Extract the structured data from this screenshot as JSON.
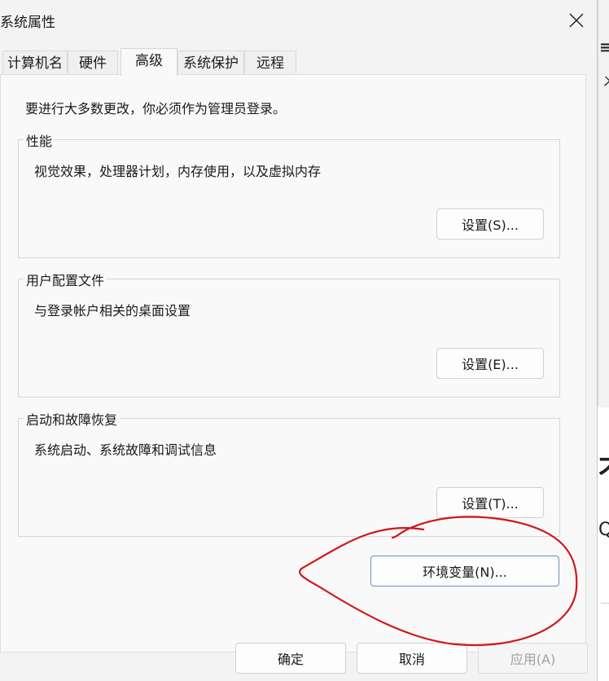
{
  "window": {
    "title": "系统属性"
  },
  "tabs": [
    {
      "label": "计算机名",
      "active": false
    },
    {
      "label": "硬件",
      "active": false
    },
    {
      "label": "高级",
      "active": true
    },
    {
      "label": "系统保护",
      "active": false
    },
    {
      "label": "远程",
      "active": false
    }
  ],
  "advanced": {
    "intro": "要进行大多数更改，你必须作为管理员登录。",
    "performance": {
      "title": "性能",
      "description": "视觉效果，处理器计划，内存使用，以及虚拟内存",
      "button": "设置(S)..."
    },
    "user_profiles": {
      "title": "用户配置文件",
      "description": "与登录帐户相关的桌面设置",
      "button": "设置(E)..."
    },
    "startup_recovery": {
      "title": "启动和故障恢复",
      "description": "系统启动、系统故障和调试信息",
      "button": "设置(T)..."
    },
    "env_button": "环境变量(N)..."
  },
  "footer": {
    "ok": "确定",
    "cancel": "取消",
    "apply": "应用(A)"
  },
  "background_app": {
    "glyph_menu": "≡",
    "glyph_x": "ㄨ",
    "glyph_big": "不",
    "glyph_q": "Q"
  },
  "colors": {
    "annotation": "#d01818",
    "focus_border": "#6a8fc1"
  }
}
